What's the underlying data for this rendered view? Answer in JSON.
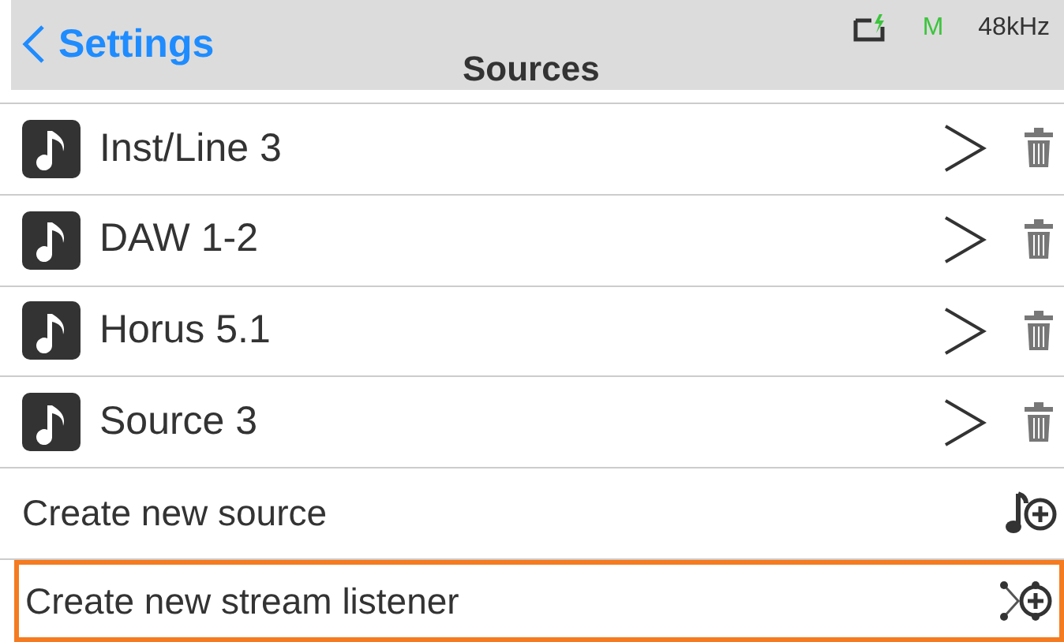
{
  "header": {
    "back_label": "Settings",
    "title": "Sources",
    "status": {
      "mode": "M",
      "sample_rate": "48kHz"
    }
  },
  "sources": [
    {
      "name": "Inst/Line 3"
    },
    {
      "name": "DAW 1-2"
    },
    {
      "name": "Horus 5.1"
    },
    {
      "name": "Source 3"
    }
  ],
  "actions": [
    {
      "label": "Create new source",
      "kind": "source",
      "selected": false
    },
    {
      "label": "Create new stream listener",
      "kind": "listener",
      "selected": true
    }
  ]
}
